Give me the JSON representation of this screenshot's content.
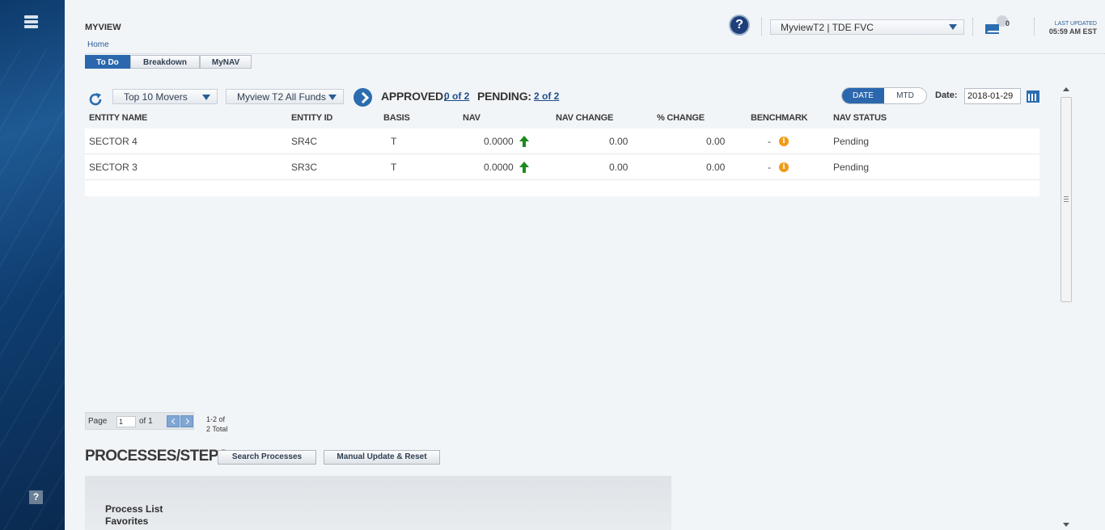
{
  "sidebar": {
    "help_glyph": "?"
  },
  "header": {
    "app_title": "MYVIEW",
    "breadcrumb": "Home",
    "help_glyph": "?",
    "fund_selector": "MyviewT2 | TDE FVC",
    "message_count": "0",
    "last_updated_label": "LAST UPDATED",
    "last_updated_time": "05:59 AM EST"
  },
  "tabs": [
    {
      "label": "To Do",
      "active": true
    },
    {
      "label": "Breakdown",
      "active": false
    },
    {
      "label": "MyNAV",
      "active": false
    }
  ],
  "toolbar": {
    "movers_dropdown": "Top 10 Movers",
    "funds_dropdown": "Myview T2 All Funds",
    "approved_label": "APPROVED:",
    "approved_value": "0 of 2",
    "pending_label": "PENDING:",
    "pending_value": "2 of 2",
    "toggle_on": "DATE",
    "toggle_off": "MTD",
    "date_label": "Date:",
    "date_value": "2018-01-29"
  },
  "table": {
    "columns": [
      "ENTITY NAME",
      "ENTITY ID",
      "BASIS",
      "NAV",
      "NAV CHANGE",
      "% CHANGE",
      "BENCHMARK",
      "NAV STATUS"
    ],
    "rows": [
      {
        "entity_name": "SECTOR 4",
        "entity_id": "SR4C",
        "basis": "T",
        "nav": "0.0000",
        "nav_change": "0.00",
        "pct_change": "0.00",
        "benchmark": "-",
        "nav_status": "Pending"
      },
      {
        "entity_name": "SECTOR 3",
        "entity_id": "SR3C",
        "basis": "T",
        "nav": "0.0000",
        "nav_change": "0.00",
        "pct_change": "0.00",
        "benchmark": "-",
        "nav_status": "Pending"
      }
    ]
  },
  "pager": {
    "page_label": "Page",
    "page_value": "1",
    "of_label": "of 1",
    "range_line1": "1-2  of",
    "range_line2": "2 Total"
  },
  "processes": {
    "title": "PROCESSES/STEPS",
    "search_button": "Search Processes",
    "manual_button": "Manual Update & Reset",
    "list_items": [
      "Process List",
      "Favorites"
    ]
  },
  "colors": {
    "accent": "#2a67ad",
    "up_arrow": "#1e8a1e",
    "info": "#f29a16"
  }
}
